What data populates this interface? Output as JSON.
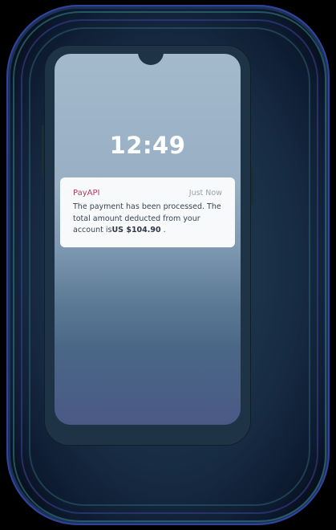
{
  "lock_screen": {
    "time": "12:49"
  },
  "notification": {
    "app_name": "PayAPI",
    "timestamp": "Just Now",
    "message_prefix": "The payment has been processed. The total amount deducted from your account is",
    "amount": "US $104.90",
    "message_suffix": " ."
  },
  "colors": {
    "app_name": "#b23c5a",
    "screen_top": "#a3b9cc",
    "screen_bottom": "#4a5a85",
    "phone_body": "#1e3446"
  }
}
